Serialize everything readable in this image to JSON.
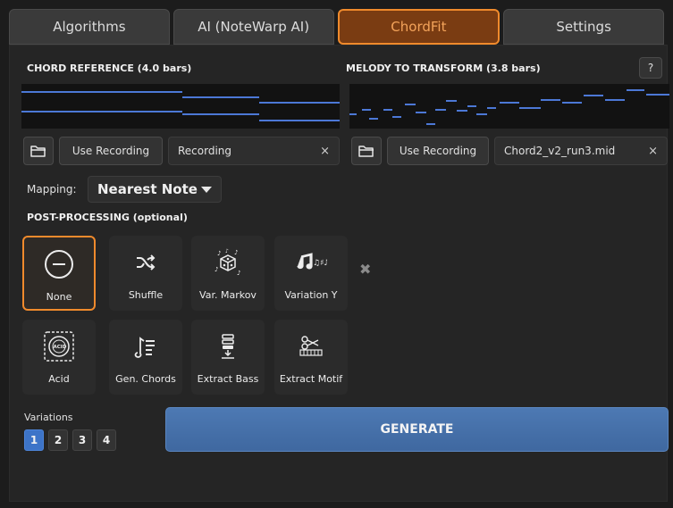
{
  "tabs": [
    {
      "label": "Algorithms",
      "active": false
    },
    {
      "label": "AI (NoteWarp AI)",
      "active": false
    },
    {
      "label": "ChordFit",
      "active": true
    },
    {
      "label": "Settings",
      "active": false
    }
  ],
  "chord_reference": {
    "title": "CHORD REFERENCE (4.0 bars)",
    "use_recording_label": "Use Recording",
    "source_value": "Recording",
    "clear_glyph": "×"
  },
  "melody": {
    "title": "MELODY TO TRANSFORM (3.8 bars)",
    "use_recording_label": "Use Recording",
    "source_value": "Chord2_v2_run3.mid",
    "clear_glyph": "×"
  },
  "help_label": "?",
  "mapping": {
    "label": "Mapping:",
    "value": "Nearest Note"
  },
  "post_processing": {
    "title": "POST-PROCESSING (optional)",
    "options": [
      {
        "label": "None",
        "icon": "minus-circle-icon",
        "selected": true
      },
      {
        "label": "Shuffle",
        "icon": "shuffle-icon",
        "selected": false
      },
      {
        "label": "Var. Markov",
        "icon": "dice-notes-icon",
        "selected": false
      },
      {
        "label": "Variation Y",
        "icon": "music-notes-icon",
        "selected": false
      },
      {
        "label": "Acid",
        "icon": "acid-stamp-icon",
        "selected": false
      },
      {
        "label": "Gen. Chords",
        "icon": "note-lines-icon",
        "selected": false
      },
      {
        "label": "Extract Bass",
        "icon": "extract-stack-icon",
        "selected": false
      },
      {
        "label": "Extract Motif",
        "icon": "scissors-keys-icon",
        "selected": false
      }
    ],
    "clear_glyph": "✖"
  },
  "variations": {
    "label": "Variations",
    "options": [
      "1",
      "2",
      "3",
      "4"
    ],
    "selected": "1"
  },
  "generate_label": "GENERATE",
  "colors": {
    "accent": "#f08a2c",
    "note": "#4c78d6",
    "generate": "#4670a8",
    "selected_variation": "#3d74c8"
  }
}
